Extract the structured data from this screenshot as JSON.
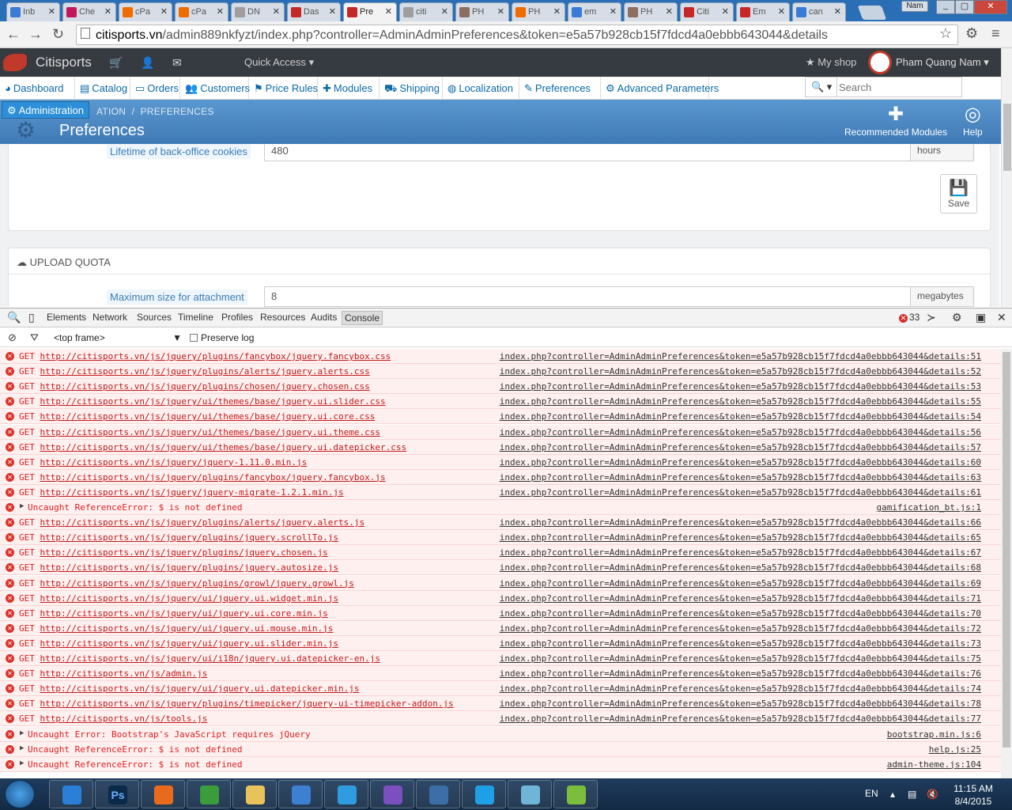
{
  "browser": {
    "tabs": [
      {
        "label": "Inb",
        "color": "#3a7bd5"
      },
      {
        "label": "Che",
        "color": "#c2185b"
      },
      {
        "label": "cPa",
        "color": "#ef6c00"
      },
      {
        "label": "cPa",
        "color": "#ef6c00"
      },
      {
        "label": "DN",
        "color": "#9e9e9e"
      },
      {
        "label": "Das",
        "color": "#c62828"
      },
      {
        "label": "Pre",
        "color": "#c62828"
      },
      {
        "label": "citi",
        "color": "#9e9e9e"
      },
      {
        "label": "PH",
        "color": "#8d6e63"
      },
      {
        "label": "PH",
        "color": "#ef6c00"
      },
      {
        "label": "em",
        "color": "#3a7bd5"
      },
      {
        "label": "PH",
        "color": "#8d6e63"
      },
      {
        "label": "Citi",
        "color": "#c62828"
      },
      {
        "label": "Em",
        "color": "#c62828"
      },
      {
        "label": "can",
        "color": "#3a7bd5"
      }
    ],
    "active_tab_index": 6,
    "user_label": "Nam",
    "url_host": "citisports.vn",
    "url_path": "/admin889nkfyzt/index.php?controller=AdminAdminPreferences&token=e5a57b928cb15f7fdcd4a0ebbb643044&details"
  },
  "header": {
    "shop_name": "Citisports",
    "quick_access": "Quick Access",
    "my_shop": "My shop",
    "username": "Pham Quang Nam"
  },
  "menu": [
    {
      "icon": "dashboard-icon",
      "glyph": "◕",
      "label": "Dashboard"
    },
    {
      "icon": "catalog-icon",
      "glyph": "▤",
      "label": "Catalog"
    },
    {
      "icon": "orders-icon",
      "glyph": "▭",
      "label": "Orders"
    },
    {
      "icon": "customers-icon",
      "glyph": "👥",
      "label": "Customers"
    },
    {
      "icon": "price-rules-icon",
      "glyph": "⚑",
      "label": "Price Rules"
    },
    {
      "icon": "modules-icon",
      "glyph": "✚",
      "label": "Modules"
    },
    {
      "icon": "shipping-icon",
      "glyph": "⛟",
      "label": "Shipping"
    },
    {
      "icon": "localization-icon",
      "glyph": "◍",
      "label": "Localization"
    },
    {
      "icon": "preferences-icon",
      "glyph": "✎",
      "label": "Preferences"
    },
    {
      "icon": "advanced-parameters-icon",
      "glyph": "⚙",
      "label": "Advanced Parameters"
    }
  ],
  "search": {
    "placeholder": "Search"
  },
  "pagehead": {
    "tooltip": "Administration",
    "breadcrumb_partial": "ATION",
    "breadcrumb_sep": "/",
    "breadcrumb_current": "PREFERENCES",
    "title": "Preferences",
    "recommended_modules": "Recommended Modules",
    "help": "Help"
  },
  "form": {
    "cookie_label": "Lifetime of back-office cookies",
    "cookie_value": "480",
    "cookie_unit": "hours",
    "save_label": "Save",
    "upload_title": "UPLOAD QUOTA",
    "attachment_label": "Maximum size for attachment",
    "attachment_value": "8",
    "attachment_unit": "megabytes"
  },
  "devtools": {
    "tabs": [
      "Elements",
      "Network",
      "Sources",
      "Timeline",
      "Profiles",
      "Resources",
      "Audits",
      "Console"
    ],
    "active_tab": "Console",
    "error_count": "33",
    "frame": "<top frame>",
    "preserve_log": "Preserve log",
    "console_rows": [
      {
        "kind": "get",
        "url": "http://citisports.vn/js/jquery/plugins/fancybox/jquery.fancybox.css",
        "src": "index.php?controller=AdminAdminPreferences&token=e5a57b928cb15f7fdcd4a0ebbb643044&details:51"
      },
      {
        "kind": "get",
        "url": "http://citisports.vn/js/jquery/plugins/alerts/jquery.alerts.css",
        "src": "index.php?controller=AdminAdminPreferences&token=e5a57b928cb15f7fdcd4a0ebbb643044&details:52"
      },
      {
        "kind": "get",
        "url": "http://citisports.vn/js/jquery/plugins/chosen/jquery.chosen.css",
        "src": "index.php?controller=AdminAdminPreferences&token=e5a57b928cb15f7fdcd4a0ebbb643044&details:53"
      },
      {
        "kind": "get",
        "url": "http://citisports.vn/js/jquery/ui/themes/base/jquery.ui.slider.css",
        "src": "index.php?controller=AdminAdminPreferences&token=e5a57b928cb15f7fdcd4a0ebbb643044&details:55"
      },
      {
        "kind": "get",
        "url": "http://citisports.vn/js/jquery/ui/themes/base/jquery.ui.core.css",
        "src": "index.php?controller=AdminAdminPreferences&token=e5a57b928cb15f7fdcd4a0ebbb643044&details:54"
      },
      {
        "kind": "get",
        "url": "http://citisports.vn/js/jquery/ui/themes/base/jquery.ui.theme.css",
        "src": "index.php?controller=AdminAdminPreferences&token=e5a57b928cb15f7fdcd4a0ebbb643044&details:56"
      },
      {
        "kind": "get",
        "url": "http://citisports.vn/js/jquery/ui/themes/base/jquery.ui.datepicker.css",
        "src": "index.php?controller=AdminAdminPreferences&token=e5a57b928cb15f7fdcd4a0ebbb643044&details:57"
      },
      {
        "kind": "get",
        "url": "http://citisports.vn/js/jquery/jquery-1.11.0.min.js",
        "src": "index.php?controller=AdminAdminPreferences&token=e5a57b928cb15f7fdcd4a0ebbb643044&details:60"
      },
      {
        "kind": "get",
        "url": "http://citisports.vn/js/jquery/plugins/fancybox/jquery.fancybox.js",
        "src": "index.php?controller=AdminAdminPreferences&token=e5a57b928cb15f7fdcd4a0ebbb643044&details:63"
      },
      {
        "kind": "get",
        "url": "http://citisports.vn/js/jquery/jquery-migrate-1.2.1.min.js",
        "src": "index.php?controller=AdminAdminPreferences&token=e5a57b928cb15f7fdcd4a0ebbb643044&details:61"
      },
      {
        "kind": "error",
        "text": "Uncaught ReferenceError: $ is not defined",
        "src": "gamification_bt.js:1"
      },
      {
        "kind": "get",
        "url": "http://citisports.vn/js/jquery/plugins/alerts/jquery.alerts.js",
        "src": "index.php?controller=AdminAdminPreferences&token=e5a57b928cb15f7fdcd4a0ebbb643044&details:66"
      },
      {
        "kind": "get",
        "url": "http://citisports.vn/js/jquery/plugins/jquery.scrollTo.js",
        "src": "index.php?controller=AdminAdminPreferences&token=e5a57b928cb15f7fdcd4a0ebbb643044&details:65"
      },
      {
        "kind": "get",
        "url": "http://citisports.vn/js/jquery/plugins/jquery.chosen.js",
        "src": "index.php?controller=AdminAdminPreferences&token=e5a57b928cb15f7fdcd4a0ebbb643044&details:67"
      },
      {
        "kind": "get",
        "url": "http://citisports.vn/js/jquery/plugins/jquery.autosize.js",
        "src": "index.php?controller=AdminAdminPreferences&token=e5a57b928cb15f7fdcd4a0ebbb643044&details:68"
      },
      {
        "kind": "get",
        "url": "http://citisports.vn/js/jquery/plugins/growl/jquery.growl.js",
        "src": "index.php?controller=AdminAdminPreferences&token=e5a57b928cb15f7fdcd4a0ebbb643044&details:69"
      },
      {
        "kind": "get",
        "url": "http://citisports.vn/js/jquery/ui/jquery.ui.widget.min.js",
        "src": "index.php?controller=AdminAdminPreferences&token=e5a57b928cb15f7fdcd4a0ebbb643044&details:71"
      },
      {
        "kind": "get",
        "url": "http://citisports.vn/js/jquery/ui/jquery.ui.core.min.js",
        "src": "index.php?controller=AdminAdminPreferences&token=e5a57b928cb15f7fdcd4a0ebbb643044&details:70"
      },
      {
        "kind": "get",
        "url": "http://citisports.vn/js/jquery/ui/jquery.ui.mouse.min.js",
        "src": "index.php?controller=AdminAdminPreferences&token=e5a57b928cb15f7fdcd4a0ebbb643044&details:72"
      },
      {
        "kind": "get",
        "url": "http://citisports.vn/js/jquery/ui/jquery.ui.slider.min.js",
        "src": "index.php?controller=AdminAdminPreferences&token=e5a57b928cb15f7fdcd4a0ebbb643044&details:73"
      },
      {
        "kind": "get",
        "url": "http://citisports.vn/js/jquery/ui/i18n/jquery.ui.datepicker-en.js",
        "src": "index.php?controller=AdminAdminPreferences&token=e5a57b928cb15f7fdcd4a0ebbb643044&details:75"
      },
      {
        "kind": "get",
        "url": "http://citisports.vn/js/admin.js",
        "src": "index.php?controller=AdminAdminPreferences&token=e5a57b928cb15f7fdcd4a0ebbb643044&details:76"
      },
      {
        "kind": "get",
        "url": "http://citisports.vn/js/jquery/ui/jquery.ui.datepicker.min.js",
        "src": "index.php?controller=AdminAdminPreferences&token=e5a57b928cb15f7fdcd4a0ebbb643044&details:74"
      },
      {
        "kind": "get",
        "url": "http://citisports.vn/js/jquery/plugins/timepicker/jquery-ui-timepicker-addon.js",
        "src": "index.php?controller=AdminAdminPreferences&token=e5a57b928cb15f7fdcd4a0ebbb643044&details:78"
      },
      {
        "kind": "get",
        "url": "http://citisports.vn/js/tools.js",
        "src": "index.php?controller=AdminAdminPreferences&token=e5a57b928cb15f7fdcd4a0ebbb643044&details:77"
      },
      {
        "kind": "error",
        "text": "Uncaught Error: Bootstrap's JavaScript requires jQuery",
        "src": "bootstrap.min.js:6"
      },
      {
        "kind": "error",
        "text": "Uncaught ReferenceError: $ is not defined",
        "src": "help.js:25"
      },
      {
        "kind": "error",
        "text": "Uncaught ReferenceError: $ is not defined",
        "src": "admin-theme.js:104"
      }
    ]
  },
  "taskbar": {
    "apps": [
      {
        "name": "internet-explorer",
        "color": "#2b7fd6"
      },
      {
        "name": "photoshop",
        "color": "#0a2a4a",
        "label": "Ps"
      },
      {
        "name": "firefox",
        "color": "#e86a1c"
      },
      {
        "name": "chrome",
        "color": "#3b9c3b"
      },
      {
        "name": "file-explorer",
        "color": "#e7c35a"
      },
      {
        "name": "word",
        "color": "#3d7fd1"
      },
      {
        "name": "app-c",
        "color": "#2f9be0"
      },
      {
        "name": "viber",
        "color": "#7b4fbf"
      },
      {
        "name": "remote-desktop",
        "color": "#3d6ea8"
      },
      {
        "name": "skype",
        "color": "#1ea0e6"
      },
      {
        "name": "app-book",
        "color": "#6fb5d8"
      },
      {
        "name": "app-chart",
        "color": "#7bbd3c"
      }
    ],
    "lang": "EN",
    "time": "11:15 AM",
    "date": "8/4/2015",
    "colors": {
      "tray_text": "#ffffff"
    }
  },
  "colors": {
    "brand_dark": "#363a41",
    "link_blue": "#0b6aa8",
    "pagehead_blue": "#4a86c0",
    "console_error": "#e02020"
  }
}
